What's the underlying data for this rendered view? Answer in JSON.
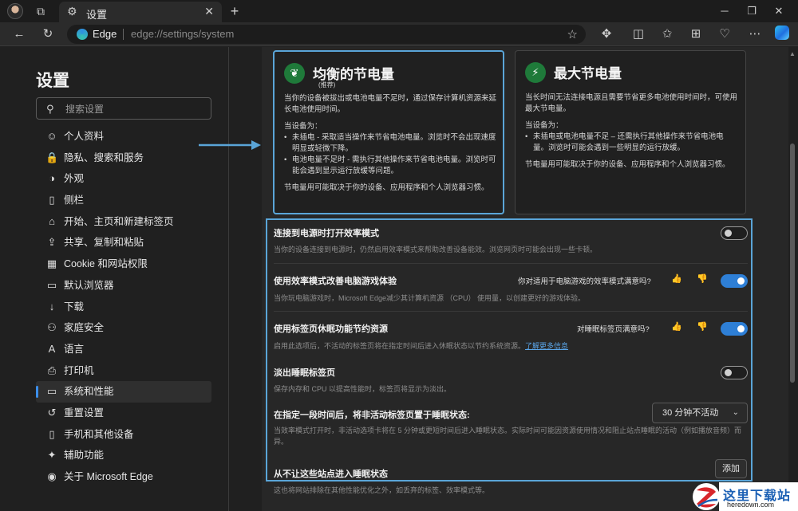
{
  "tab": {
    "title": "设置"
  },
  "address": {
    "site_name": "Edge",
    "url": "edge://settings/system"
  },
  "sidebar": {
    "title": "设置",
    "search_placeholder": "搜索设置",
    "items": [
      {
        "label": "个人资料",
        "icon": "profile-icon"
      },
      {
        "label": "隐私、搜索和服务",
        "icon": "lock-icon"
      },
      {
        "label": "外观",
        "icon": "appearance-icon"
      },
      {
        "label": "侧栏",
        "icon": "sidebar-icon"
      },
      {
        "label": "开始、主页和新建标签页",
        "icon": "home-icon"
      },
      {
        "label": "共享、复制和粘贴",
        "icon": "share-icon"
      },
      {
        "label": "Cookie 和网站权限",
        "icon": "cookie-icon"
      },
      {
        "label": "默认浏览器",
        "icon": "browser-icon"
      },
      {
        "label": "下载",
        "icon": "download-icon"
      },
      {
        "label": "家庭安全",
        "icon": "family-icon"
      },
      {
        "label": "语言",
        "icon": "language-icon"
      },
      {
        "label": "打印机",
        "icon": "printer-icon"
      },
      {
        "label": "系统和性能",
        "icon": "system-icon",
        "active": true
      },
      {
        "label": "重置设置",
        "icon": "reset-icon"
      },
      {
        "label": "手机和其他设备",
        "icon": "phone-icon"
      },
      {
        "label": "辅助功能",
        "icon": "accessibility-icon"
      },
      {
        "label": "关于 Microsoft Edge",
        "icon": "edge-icon"
      }
    ]
  },
  "cards": {
    "balanced": {
      "title": "均衡的节电量",
      "subtitle": "(推荐)",
      "desc": "当你的设备被拔出或电池电量不足时，通过保存计算机资源来延长电池使用时间。",
      "when_label": "当设备为：",
      "bullets": [
        "未插电 - 采取适当操作来节省电池电量。浏览时不会出现速度明显或轻微下降。",
        "电池电量不足时 - 需执行其他操作来节省电池电量。浏览时可能会遇到显示运行放缓等问题。"
      ],
      "note": "节电量用可能取决于你的设备、应用程序和个人浏览器习惯。"
    },
    "maximum": {
      "title": "最大节电量",
      "desc": "当长时间无法连接电源且需要节省更多电池使用时间时，可使用最大节电量。",
      "when_label": "当设备为：",
      "bullets": [
        "未插电或电池电量不足 – 还需执行其他操作来节省电池电量。浏览时可能会遇到一些明显的运行放缓。"
      ],
      "note": "节电量用可能取决于你的设备、应用程序和个人浏览器习惯。"
    }
  },
  "settings": {
    "efficiency_plugged": {
      "title": "连接到电源时打开效率模式",
      "desc": "当你的设备连接到电源时，仍然启用效率模式来帮助改善设备能效。浏览网页时可能会出现一些卡顿。",
      "enabled": false
    },
    "gaming": {
      "title": "使用效率模式改善电脑游戏体验",
      "question": "你对适用于电脑游戏的效率模式满意吗?",
      "desc": "当你玩电脑游戏时，Microsoft Edge减少其计算机资源 （CPU） 使用量，以创建更好的游戏体验。",
      "enabled": true
    },
    "sleeping_tabs": {
      "title": "使用标签页休眠功能节约资源",
      "question": "对睡眠标签页满意吗?",
      "desc": "启用此选项后，不活动的标签页将在指定时间后进入休眠状态以节约系统资源。",
      "link": "了解更多信息",
      "enabled": true
    },
    "fade_tabs": {
      "title": "淡出睡眠标签页",
      "desc": "保存内存和 CPU 以提高性能时，标签页将显示为淡出。",
      "enabled": false
    },
    "inactive_timeout": {
      "title": "在指定一段时间后，将非活动标签页置于睡眠状态:",
      "desc": "当效率模式打开时，非活动选项卡将在 5 分钟或更短时间后进入睡眠状态。实际时间可能因资源使用情况和阻止站点睡眠的活动（例如播放音频）而异。",
      "selected": "30 分钟不活动"
    },
    "never_sleep": {
      "title": "从不让这些站点进入睡眠状态",
      "add_label": "添加",
      "desc": "这也将网站排除在其他性能优化之外，如丢弃的标签、效率模式等。"
    }
  },
  "watermark": {
    "cn": "这里下载站",
    "en": "heredown.com"
  }
}
